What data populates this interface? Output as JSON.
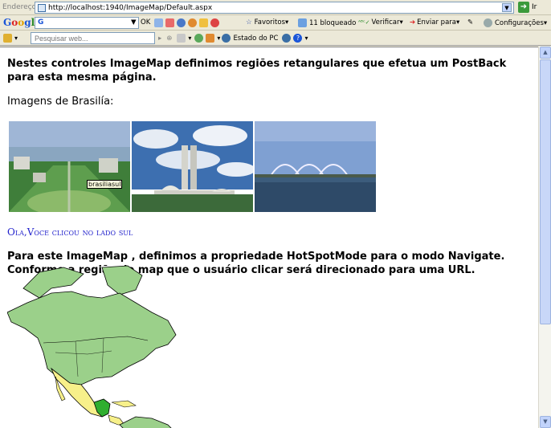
{
  "address_bar": {
    "label": "Endereço",
    "url": "http://localhost:1940/ImageMap/Default.aspx",
    "go_label": "Ir"
  },
  "google_toolbar": {
    "search_value": "G",
    "ok_label": "OK",
    "favorites_label": "Favoritos",
    "blocked_label": "11 bloqueado",
    "spell_label": "Verificar",
    "send_label": "Enviar para",
    "settings_label": "Configurações"
  },
  "search_toolbar": {
    "placeholder": "Pesquisar web...",
    "pc_status_label": "Estado do PC"
  },
  "page": {
    "intro": "Nestes controles ImageMap definimos regiões retangulares que efetua um PostBack para esta mesma página.",
    "images_label": "Imagens de Brasilía:",
    "tooltip": "brasiliasul",
    "result": "Ola,Voce clicou no lado sul",
    "navigate_line1": "Para este ImageMap , definimos a propriedade HotSpotMode para o modo Navigate.",
    "navigate_line2": "Conforme a região do map que o usuário clicar será direcionado para uma URL."
  },
  "colors": {
    "result_text": "#2222cc",
    "map_land": "#9bd08a",
    "map_mexico": "#f7f08a",
    "map_central": "#2fae2f"
  }
}
